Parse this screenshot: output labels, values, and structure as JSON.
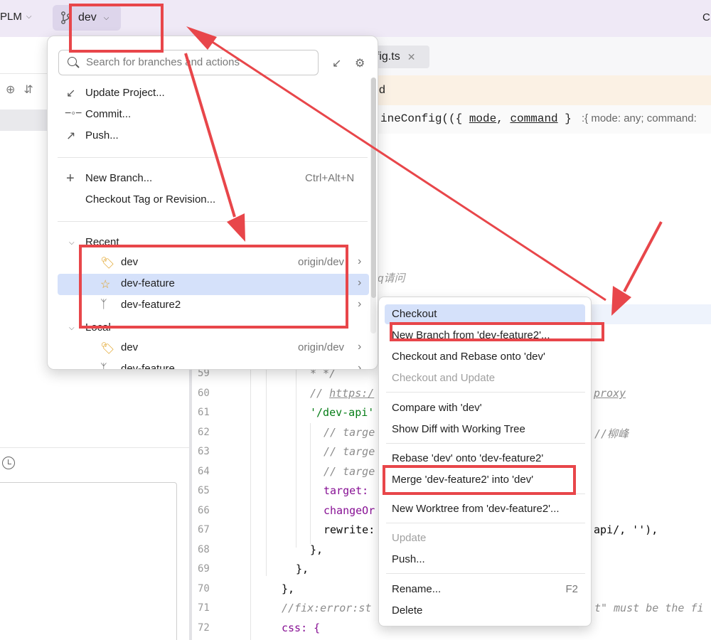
{
  "titlebar": {
    "project": "PLM",
    "branch": "dev",
    "right_fragment": "C"
  },
  "editor": {
    "tab_label": "nfig.ts",
    "warning_fragment": "d",
    "top_code": {
      "prefix": "ineConfig(({ ",
      "mode": "mode",
      "sep": ", ",
      "command": "command",
      "suffix": " }",
      "hint": ":{ mode: any; command:"
    },
    "comment_fragment": "weq请问",
    "line_numbers": [
      "59",
      "60",
      "61",
      "62",
      "63",
      "64",
      "65",
      "66",
      "67",
      "68",
      "69",
      "70",
      "71",
      "72"
    ],
    "lines": {
      "l59": "* */",
      "l60_a": "// ",
      "l60_link": "https:/",
      "l60_b": "proxy",
      "l61": "'/dev-api'",
      "l62_a": "// targe",
      "l62_b": "//柳峰",
      "l63": "// targe",
      "l64": "// targe",
      "l65": "target:",
      "l66": "changeOr",
      "l67_a": "rewrite:",
      "l67_b": "api/, ''),",
      "l68": "},",
      "l69": "},",
      "l70": "},",
      "l71_a": "//fix:error:st",
      "l71_b": "t\" must be the fi",
      "l72": "css: {"
    }
  },
  "branches_popup": {
    "search_placeholder": "Search for branches and actions",
    "actions": [
      {
        "label": "Update Project...",
        "icon": "update-icon"
      },
      {
        "label": "Commit...",
        "icon": "commit-icon"
      },
      {
        "label": "Push...",
        "icon": "push-icon"
      }
    ],
    "new_branch": {
      "label": "New Branch...",
      "shortcut": "Ctrl+Alt+N"
    },
    "checkout_tag": "Checkout Tag or Revision...",
    "recent_label": "Recent",
    "recent": [
      {
        "name": "dev",
        "remote": "origin/dev",
        "icon": "tag-icon"
      },
      {
        "name": "dev-feature",
        "remote": "",
        "icon": "star-icon"
      },
      {
        "name": "dev-feature2",
        "remote": "",
        "icon": "branch-icon"
      }
    ],
    "local_label": "Local",
    "local": [
      {
        "name": "dev",
        "remote": "origin/dev",
        "icon": "tag-icon"
      },
      {
        "name": "dev-feature",
        "remote": "",
        "icon": "branch-icon"
      }
    ]
  },
  "context_menu": {
    "checkout": "Checkout",
    "new_branch_from": "New Branch from 'dev-feature2'...",
    "checkout_rebase": "Checkout and Rebase onto 'dev'",
    "checkout_update": "Checkout and Update",
    "compare": "Compare with 'dev'",
    "show_diff": "Show Diff with Working Tree",
    "rebase": "Rebase 'dev' onto 'dev-feature2'",
    "merge": "Merge 'dev-feature2' into 'dev'",
    "new_worktree": "New Worktree from 'dev-feature2'...",
    "update": "Update",
    "push": "Push...",
    "rename": "Rename...",
    "rename_shortcut": "F2",
    "delete": "Delete"
  },
  "colors": {
    "annotation_red": "#e8464a",
    "selection_blue": "#d5e1fa",
    "titlebar": "#efe9f6"
  }
}
